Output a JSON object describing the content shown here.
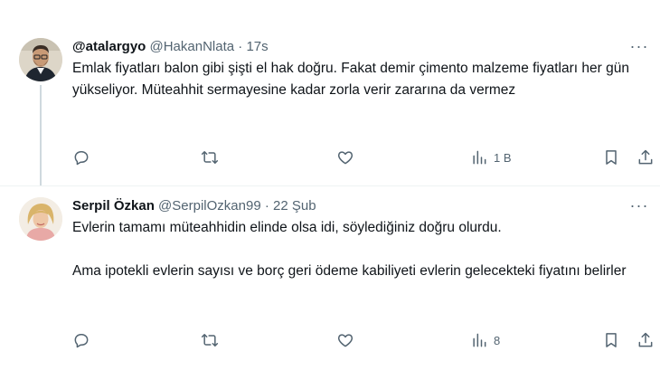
{
  "tweets": [
    {
      "display_name": "@atalargyo",
      "handle": "@HakanNlata",
      "separator": "·",
      "time": "17s",
      "more": "···",
      "paragraphs": [
        "Emlak fiyatları balon gibi şişti el hak doğru. Fakat demir çimento malzeme fiyatları her gün yükseliyor. Müteahhit sermayesine kadar zorla verir zararına da vermez"
      ],
      "actions": {
        "replies": "",
        "retweets": "",
        "likes": "",
        "views": "1 B"
      }
    },
    {
      "display_name": "Serpil Özkan",
      "handle": "@SerpilOzkan99",
      "separator": "·",
      "time": "22 Şub",
      "more": "···",
      "paragraphs": [
        "Evlerin tamamı müteahhidin elinde olsa idi, söylediğiniz doğru olurdu.",
        "Ama ipotekli evlerin sayısı ve borç geri ödeme kabiliyeti evlerin gelecekteki fiyatını belirler"
      ],
      "actions": {
        "replies": "",
        "retweets": "",
        "likes": "",
        "views": "8"
      }
    }
  ],
  "colors": {
    "text_primary": "#0f1419",
    "text_secondary": "#536471",
    "thread_line": "#cfd9de",
    "divider": "#eff3f4"
  },
  "icons": [
    "reply-icon",
    "retweet-icon",
    "like-icon",
    "views-icon",
    "bookmark-icon",
    "share-icon",
    "more-icon"
  ]
}
